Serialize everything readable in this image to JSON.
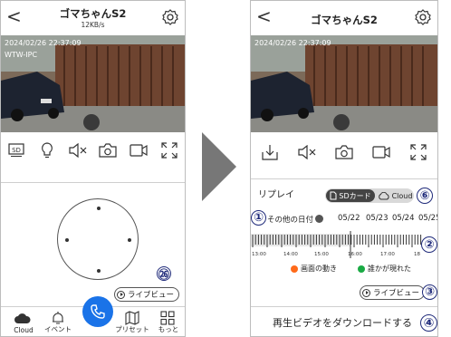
{
  "left_phone": {
    "title": "ゴマちゃんS2",
    "speed": "12KB/s",
    "timestamp": "2024/02/26 22:37:09",
    "camera_label": "WTW-IPC",
    "toolbar_icons": [
      "sd-icon",
      "bulb-icon",
      "speaker-mute-icon",
      "camera-icon",
      "record-icon",
      "fullscreen-icon"
    ],
    "badge": "㉖",
    "live_view": "ライブビュー",
    "bottom_nav": [
      "Cloud",
      "イベント",
      "",
      "プリセット",
      "もっと"
    ]
  },
  "right_phone": {
    "title": "ゴマちゃんS2",
    "timestamp": "2024/02/26 22:37:09",
    "toolbar_icons": [
      "download-icon",
      "speaker-mute-icon",
      "camera-icon",
      "record-icon",
      "fullscreen-icon"
    ],
    "replay_label": "リプレイ",
    "sd_tab": "SDカード",
    "cloud_tab": "Cloud",
    "other_date": "その他の日付",
    "dates": [
      "05/22",
      "05/23",
      "05/24",
      "05/25"
    ],
    "times": [
      "13:00",
      "14:00",
      "15:00",
      "16:00",
      "17:00",
      "18"
    ],
    "legend_motion": "画面の動き",
    "legend_person": "誰かが現れた",
    "live_view": "ライブビュー",
    "download": "再生ビデオをダウンロードする",
    "badges": [
      "①",
      "②",
      "③",
      "④",
      "⑥"
    ]
  },
  "colors": {
    "accent_blue": "#1a73e8",
    "motion": "#ff6a1a",
    "person": "#1aaa44",
    "badge": "#1f2a7a"
  }
}
